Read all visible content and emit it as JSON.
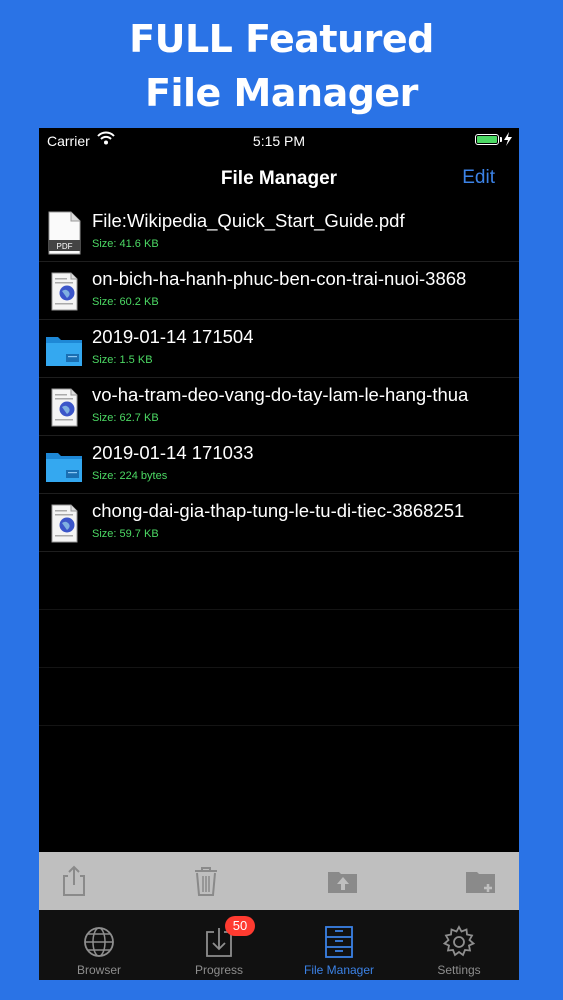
{
  "headline": {
    "line1": "FULL Featured",
    "line2": "File Manager"
  },
  "status_bar": {
    "carrier": "Carrier",
    "time": "5:15 PM"
  },
  "nav": {
    "title": "File Manager",
    "edit_label": "Edit"
  },
  "files": [
    {
      "name": "File:Wikipedia_Quick_Start_Guide.pdf",
      "size": "Size: 41.6 KB",
      "kind": "pdf",
      "icon_label": "PDF"
    },
    {
      "name": "on-bich-ha-hanh-phuc-ben-con-trai-nuoi-3868",
      "size": "Size: 60.2 KB",
      "kind": "web"
    },
    {
      "name": "2019-01-14 171504",
      "size": "Size: 1.5 KB",
      "kind": "folder"
    },
    {
      "name": "vo-ha-tram-deo-vang-do-tay-lam-le-hang-thua",
      "size": "Size: 62.7 KB",
      "kind": "web"
    },
    {
      "name": "2019-01-14 171033",
      "size": "Size: 224 bytes",
      "kind": "folder"
    },
    {
      "name": "chong-dai-gia-thap-tung-le-tu-di-tiec-3868251",
      "size": "Size: 59.7 KB",
      "kind": "web"
    }
  ],
  "toolbar": {
    "icons": [
      "share-icon",
      "trash-icon",
      "folder-upload-icon",
      "new-folder-icon"
    ]
  },
  "tabs": [
    {
      "label": "Browser",
      "icon": "globe-icon",
      "active": false
    },
    {
      "label": "Progress",
      "icon": "download-icon",
      "active": false,
      "badge": "50"
    },
    {
      "label": "File Manager",
      "icon": "file-cabinet-icon",
      "active": true
    },
    {
      "label": "Settings",
      "icon": "gear-icon",
      "active": false
    }
  ],
  "colors": {
    "background": "#2a73e6",
    "accent": "#3b82e6",
    "size_text": "#4cd964",
    "badge": "#ff3b30",
    "toolbar": "#bfbfbf"
  }
}
